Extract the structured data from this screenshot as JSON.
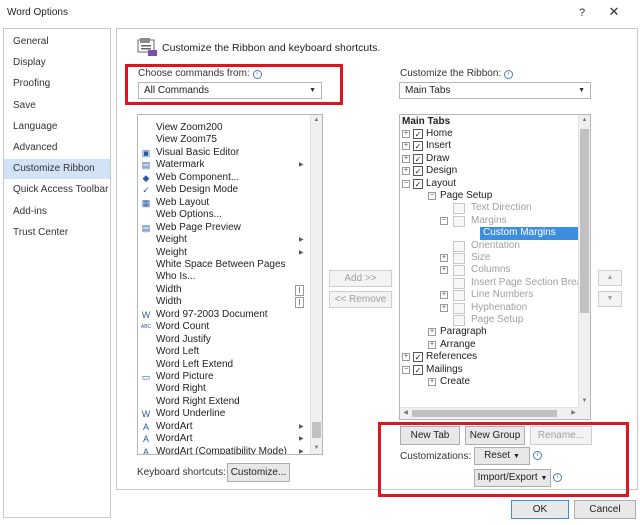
{
  "window": {
    "title": "Word Options",
    "help": "?",
    "close": "✕"
  },
  "sidebar": {
    "items": [
      {
        "label": "General"
      },
      {
        "label": "Display"
      },
      {
        "label": "Proofing"
      },
      {
        "label": "Save"
      },
      {
        "label": "Language"
      },
      {
        "label": "Advanced"
      },
      {
        "label": "Customize Ribbon",
        "selected": true
      },
      {
        "label": "Quick Access Toolbar"
      },
      {
        "label": "Add-ins"
      },
      {
        "label": "Trust Center"
      }
    ]
  },
  "header": {
    "text": "Customize the Ribbon and keyboard shortcuts."
  },
  "choose_commands": {
    "label": "Choose commands from:",
    "value": "All Commands"
  },
  "customize_ribbon": {
    "label": "Customize the Ribbon:",
    "value": "Main Tabs"
  },
  "commands": [
    {
      "label": "View Zoom200",
      "icon": ""
    },
    {
      "label": "View Zoom75",
      "icon": ""
    },
    {
      "label": "Visual Basic Editor",
      "icon": "▣"
    },
    {
      "label": "Watermark",
      "icon": "▤",
      "submenu": true
    },
    {
      "label": "Web Component...",
      "icon": "◆"
    },
    {
      "label": "Web Design Mode",
      "icon": "✓"
    },
    {
      "label": "Web Layout",
      "icon": "▦"
    },
    {
      "label": "Web Options...",
      "icon": ""
    },
    {
      "label": "Web Page Preview",
      "icon": "▤"
    },
    {
      "label": "Weight",
      "icon": "",
      "submenu": true
    },
    {
      "label": "Weight",
      "icon": "",
      "submenu": true
    },
    {
      "label": "White Space Between Pages",
      "icon": ""
    },
    {
      "label": "Who Is...",
      "icon": ""
    },
    {
      "label": "Width",
      "icon": "",
      "spin": true
    },
    {
      "label": "Width",
      "icon": "",
      "spin": true
    },
    {
      "label": "Word 97-2003 Document",
      "icon": "W"
    },
    {
      "label": "Word Count",
      "icon": "ABC"
    },
    {
      "label": "Word Justify",
      "icon": ""
    },
    {
      "label": "Word Left",
      "icon": ""
    },
    {
      "label": "Word Left Extend",
      "icon": ""
    },
    {
      "label": "Word Picture",
      "icon": "▭"
    },
    {
      "label": "Word Right",
      "icon": ""
    },
    {
      "label": "Word Right Extend",
      "icon": ""
    },
    {
      "label": "Word Underline",
      "icon": "W"
    },
    {
      "label": "WordArt",
      "icon": "A",
      "submenu": true
    },
    {
      "label": "WordArt",
      "icon": "A",
      "submenu": true
    },
    {
      "label": "WordArt (Compatibility Mode)",
      "icon": "A",
      "submenu": true
    }
  ],
  "middle": {
    "add": "Add >>",
    "remove": "<< Remove"
  },
  "tree": {
    "header": "Main Tabs",
    "rows": [
      {
        "label": "Home",
        "level": 0,
        "exp": "+",
        "check": true
      },
      {
        "label": "Insert",
        "level": 0,
        "exp": "+",
        "check": true
      },
      {
        "label": "Draw",
        "level": 0,
        "exp": "+",
        "check": true
      },
      {
        "label": "Design",
        "level": 0,
        "exp": "+",
        "check": true
      },
      {
        "label": "Layout",
        "level": 0,
        "exp": "−",
        "check": true
      },
      {
        "label": "Page Setup",
        "level": 1,
        "exp": "−"
      },
      {
        "label": "Text Direction",
        "level": 2,
        "dis": true
      },
      {
        "label": "Margins",
        "level": 2,
        "exp": "−",
        "dis": true
      },
      {
        "label": "Custom Margins",
        "level": 3,
        "sel": true
      },
      {
        "label": "Orientation",
        "level": 2,
        "dis": true
      },
      {
        "label": "Size",
        "level": 2,
        "exp": "+",
        "dis": true
      },
      {
        "label": "Columns",
        "level": 2,
        "exp": "+",
        "dis": true
      },
      {
        "label": "Insert Page  Section Breaks",
        "level": 2,
        "dis": true
      },
      {
        "label": "Line Numbers",
        "level": 2,
        "exp": "+",
        "dis": true
      },
      {
        "label": "Hyphenation",
        "level": 2,
        "exp": "+",
        "dis": true
      },
      {
        "label": "Page Setup",
        "level": 2,
        "dis": true
      },
      {
        "label": "Paragraph",
        "level": 1,
        "exp": "+"
      },
      {
        "label": "Arrange",
        "level": 1,
        "exp": "+"
      },
      {
        "label": "References",
        "level": 0,
        "exp": "+",
        "check": true
      },
      {
        "label": "Mailings",
        "level": 0,
        "exp": "−",
        "check": true
      },
      {
        "label": "Create",
        "level": 1,
        "exp": "+"
      }
    ]
  },
  "tree_buttons": {
    "new_tab": "New Tab",
    "new_group": "New Group",
    "rename": "Rename..."
  },
  "customizations": {
    "label": "Customizations:",
    "reset": "Reset",
    "import_export": "Import/Export"
  },
  "keyboard": {
    "label": "Keyboard shortcuts:",
    "button": "Customize..."
  },
  "footer": {
    "ok": "OK",
    "cancel": "Cancel"
  },
  "colors": {
    "highlight": "#e3121c",
    "selection": "#3e8ee0",
    "sidebar_selected": "#d2e3f5"
  }
}
